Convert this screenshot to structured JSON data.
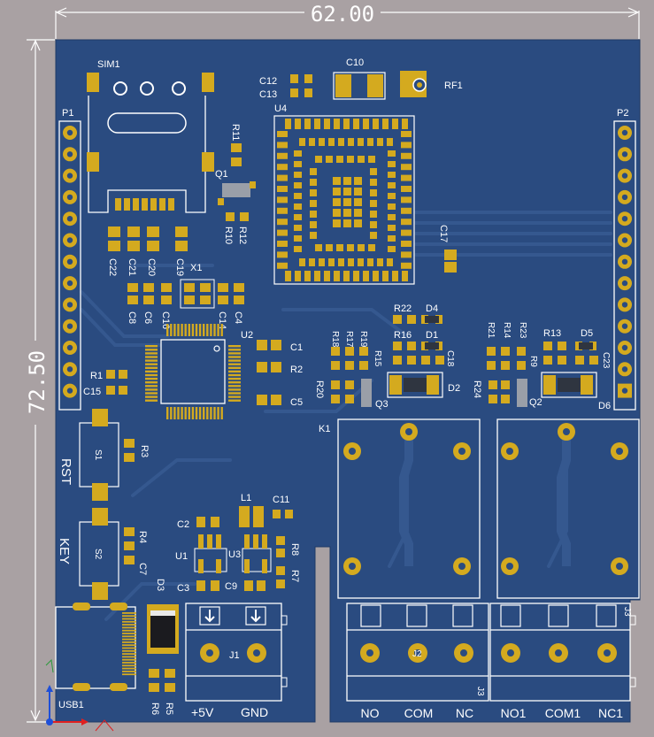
{
  "board": {
    "dimensions": {
      "width_label": "62.00",
      "height_label": "72.50"
    },
    "colors": {
      "background": "#a9a1a3",
      "board": "#2a4b80",
      "board_dark": "#223f6e",
      "trace": "#35588f",
      "pad": "#d4aa1f",
      "pad_dark": "#b38b10",
      "silk": "#ffffff",
      "chip": "#2f3540",
      "component_grey": "#9a9fa8"
    },
    "headers": {
      "p1": "P1",
      "p2": "P2"
    },
    "top_labels": {
      "sim": "SIM1",
      "c12": "C12",
      "c13": "C13",
      "c10": "C10",
      "rf1": "RF1",
      "u4": "U4",
      "r11": "R11",
      "q1": "Q1",
      "r10": "R10",
      "r12": "R12",
      "c17": "C17"
    },
    "cap_row_labels": {
      "c22": "C22",
      "c21": "C21",
      "c20": "C20",
      "c19": "C19"
    },
    "mcu_labels": {
      "x1": "X1",
      "c8": "C8",
      "c6": "C6",
      "c16": "C16",
      "c14": "C14",
      "c4": "C4",
      "u2": "U2",
      "c1": "C1",
      "r2": "R2",
      "c5": "C5",
      "r1": "R1",
      "c15": "C15"
    },
    "relay1_labels": {
      "r22": "R22",
      "d4": "D4",
      "r18": "R18",
      "r17": "R17",
      "r19": "R19",
      "r16": "R16",
      "d1": "D1",
      "r15": "R15",
      "c18": "C18",
      "r20": "R20",
      "q3": "Q3",
      "d2": "D2"
    },
    "relay2_labels": {
      "r21": "R21",
      "r14": "R14",
      "r23": "R23",
      "r13": "R13",
      "d5": "D5",
      "r9": "R9",
      "c23": "C23",
      "r24": "R24",
      "q2": "Q2",
      "d6": "D6"
    },
    "left_labels": {
      "rst": "RST",
      "s1": "S1",
      "r3": "R3",
      "key": "KEY",
      "s2": "S2",
      "r4": "R4",
      "c7": "C7"
    },
    "power_labels": {
      "l1": "L1",
      "c11": "C11",
      "c2": "C2",
      "u1": "U1",
      "u3": "U3",
      "r8": "R8",
      "r7": "R7",
      "c3": "C3",
      "c9": "C9",
      "d3": "D3",
      "r6": "R6",
      "r5": "R5",
      "usb1": "USB1",
      "j1": "J1",
      "plus5v": "+5V",
      "gnd": "GND"
    },
    "relay_labels": {
      "k1": "K1",
      "j2": "J2",
      "j3": "J3",
      "j3_rot": "J3"
    },
    "terminal_labels": {
      "no": "NO",
      "com": "COM",
      "nc": "NC",
      "no1": "NO1",
      "com1": "COM1",
      "nc1": "NC1"
    }
  }
}
